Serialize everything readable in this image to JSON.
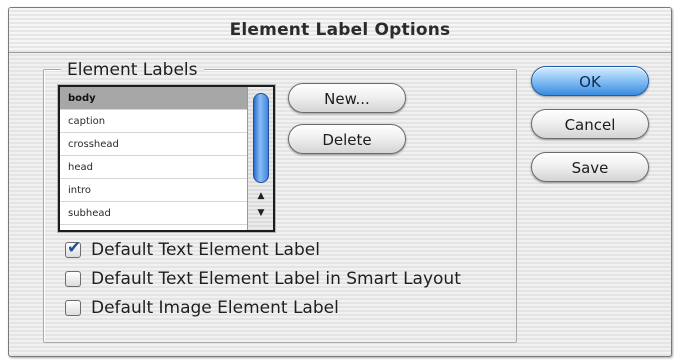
{
  "dialog": {
    "title": "Element Label Options"
  },
  "element_labels": {
    "legend": "Element Labels",
    "items": [
      "body",
      "caption",
      "crosshead",
      "head",
      "intro",
      "subhead"
    ],
    "selected": "body"
  },
  "buttons": {
    "new": "New...",
    "delete": "Delete",
    "ok": "OK",
    "cancel": "Cancel",
    "save": "Save"
  },
  "checkboxes": [
    {
      "label": "Default Text Element Label",
      "checked": true
    },
    {
      "label": "Default Text Element Label in Smart Layout",
      "checked": false
    },
    {
      "label": "Default Image Element Label",
      "checked": false
    }
  ],
  "icons": {
    "scroll_up": "▲",
    "scroll_down": "▼",
    "check": "✔"
  },
  "colors": {
    "default_button": "#3a8be0",
    "selection": "#a7a7a7",
    "check_mark": "#1c4f9c"
  }
}
